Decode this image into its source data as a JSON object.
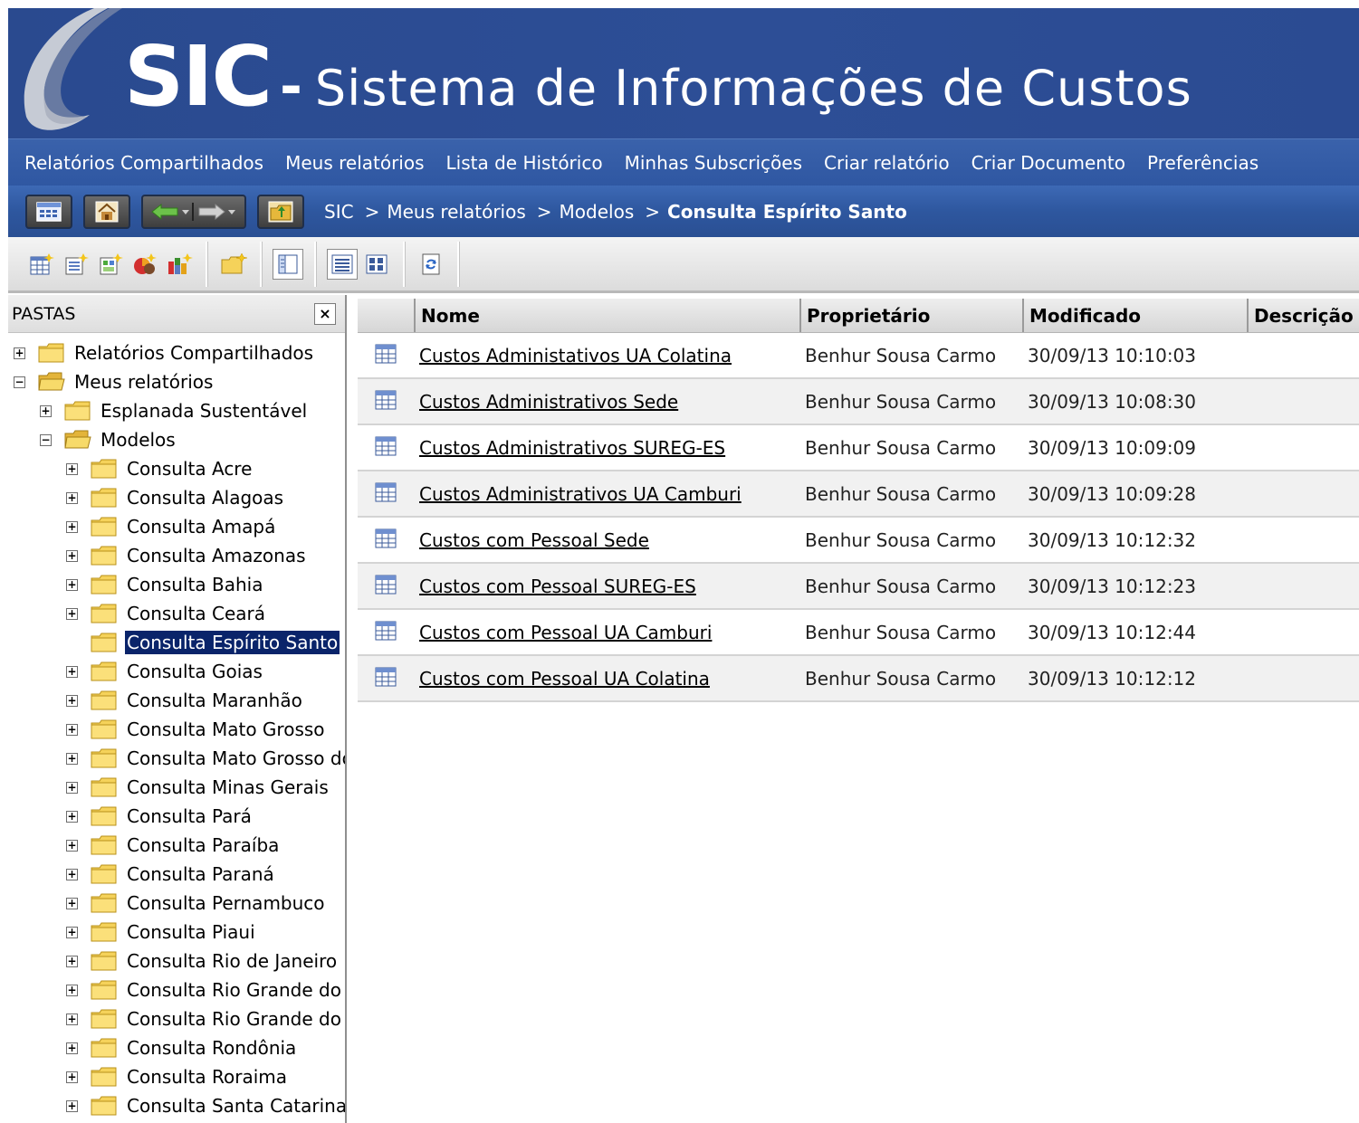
{
  "banner": {
    "sic": "SIC",
    "dash": "-",
    "title": "Sistema de Informações de Custos"
  },
  "menu": [
    "Relatórios Compartilhados",
    "Meus relatórios",
    "Lista de Histórico",
    "Minhas Subscrições",
    "Criar relatório",
    "Criar Documento",
    "Preferências"
  ],
  "breadcrumb": {
    "items": [
      "SIC",
      "Meus relatórios",
      "Modelos"
    ],
    "separator": ">",
    "current": "Consulta Espírito Santo"
  },
  "folders": {
    "title": "PASTAS",
    "close": "×",
    "nodes": [
      {
        "label": "Relatórios Compartilhados",
        "level": 0,
        "exp": "+"
      },
      {
        "label": "Meus relatórios",
        "level": 0,
        "exp": "−",
        "open": true
      },
      {
        "label": "Esplanada Sustentável",
        "level": 1,
        "exp": "+"
      },
      {
        "label": "Modelos",
        "level": 1,
        "exp": "−",
        "open": true
      },
      {
        "label": "Consulta Acre",
        "level": 2,
        "exp": "+"
      },
      {
        "label": "Consulta Alagoas",
        "level": 2,
        "exp": "+"
      },
      {
        "label": "Consulta Amapá",
        "level": 2,
        "exp": "+"
      },
      {
        "label": "Consulta Amazonas",
        "level": 2,
        "exp": "+"
      },
      {
        "label": "Consulta Bahia",
        "level": 2,
        "exp": "+"
      },
      {
        "label": "Consulta Ceará",
        "level": 2,
        "exp": "+"
      },
      {
        "label": "Consulta Espírito Santo",
        "level": 2,
        "exp": "",
        "selected": true
      },
      {
        "label": "Consulta Goias",
        "level": 2,
        "exp": "+"
      },
      {
        "label": "Consulta Maranhão",
        "level": 2,
        "exp": "+"
      },
      {
        "label": "Consulta Mato Grosso",
        "level": 2,
        "exp": "+"
      },
      {
        "label": "Consulta Mato Grosso do Sul",
        "level": 2,
        "exp": "+"
      },
      {
        "label": "Consulta Minas Gerais",
        "level": 2,
        "exp": "+"
      },
      {
        "label": "Consulta Pará",
        "level": 2,
        "exp": "+"
      },
      {
        "label": "Consulta Paraíba",
        "level": 2,
        "exp": "+"
      },
      {
        "label": "Consulta Paraná",
        "level": 2,
        "exp": "+"
      },
      {
        "label": "Consulta Pernambuco",
        "level": 2,
        "exp": "+"
      },
      {
        "label": "Consulta Piaui",
        "level": 2,
        "exp": "+"
      },
      {
        "label": "Consulta Rio de Janeiro",
        "level": 2,
        "exp": "+"
      },
      {
        "label": "Consulta Rio Grande do Norte",
        "level": 2,
        "exp": "+"
      },
      {
        "label": "Consulta Rio Grande do Sul",
        "level": 2,
        "exp": "+"
      },
      {
        "label": "Consulta Rondônia",
        "level": 2,
        "exp": "+"
      },
      {
        "label": "Consulta Roraima",
        "level": 2,
        "exp": "+"
      },
      {
        "label": "Consulta Santa Catarina",
        "level": 2,
        "exp": "+"
      }
    ]
  },
  "table": {
    "columns": [
      "",
      "Nome",
      "Proprietário",
      "Modificado",
      "Descrição"
    ],
    "rows": [
      {
        "name": "Custos Administativos UA Colatina",
        "owner": "Benhur Sousa Carmo",
        "modified": "30/09/13 10:10:03"
      },
      {
        "name": "Custos Administrativos Sede",
        "owner": "Benhur Sousa Carmo",
        "modified": "30/09/13 10:08:30"
      },
      {
        "name": "Custos Administrativos SUREG-ES",
        "owner": "Benhur Sousa Carmo",
        "modified": "30/09/13 10:09:09"
      },
      {
        "name": "Custos Administrativos UA Camburi",
        "owner": "Benhur Sousa Carmo",
        "modified": "30/09/13 10:09:28"
      },
      {
        "name": "Custos com Pessoal Sede",
        "owner": "Benhur Sousa Carmo",
        "modified": "30/09/13 10:12:32"
      },
      {
        "name": "Custos com Pessoal SUREG-ES",
        "owner": "Benhur Sousa Carmo",
        "modified": "30/09/13 10:12:23"
      },
      {
        "name": "Custos com Pessoal UA Camburi",
        "owner": "Benhur Sousa Carmo",
        "modified": "30/09/13 10:12:44"
      },
      {
        "name": "Custos com Pessoal UA Colatina",
        "owner": "Benhur Sousa Carmo",
        "modified": "30/09/13 10:12:12"
      }
    ]
  },
  "icons": {
    "report": "report-grid-icon",
    "folder": "folder-icon",
    "folder_open": "folder-open-icon"
  },
  "colors": {
    "banner": "#2d4e96",
    "menu": "#3560a8",
    "selection": "#0a246a",
    "folder": "#f5d25a"
  }
}
